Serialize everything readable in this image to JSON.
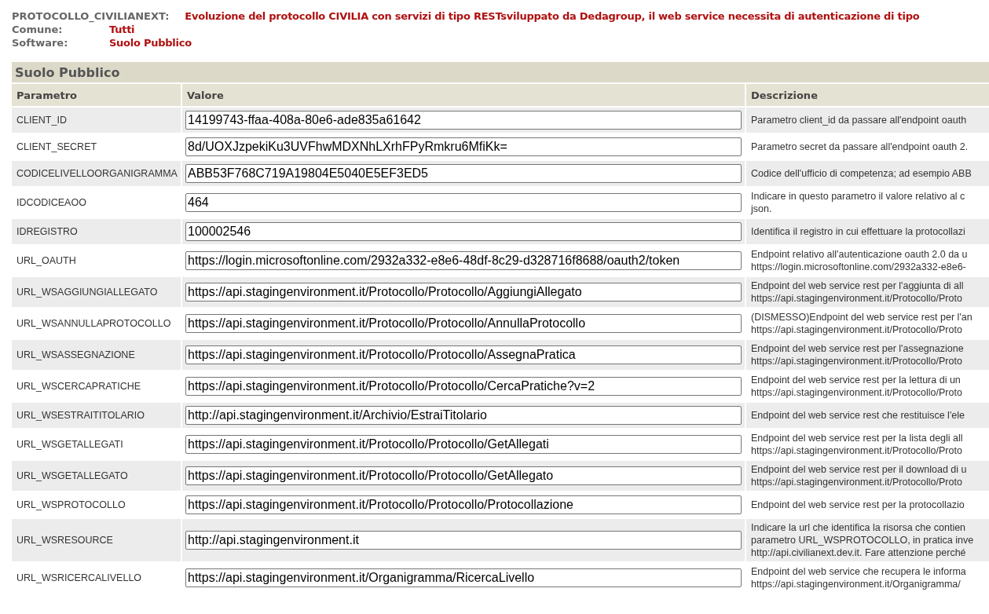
{
  "info": [
    {
      "label": "PROTOCOLLO_CIVILIANEXT:",
      "value": "Evoluzione del protocollo CIVILIA con servizi di tipo RESTsviluppato da Dedagroup, il web service necessita di autenticazione di tipo"
    },
    {
      "label": "Comune:",
      "value": "Tutti"
    },
    {
      "label": "Software:",
      "value": "Suolo Pubblico"
    }
  ],
  "section_title": "Suolo Pubblico",
  "columns": [
    "Parametro",
    "Valore",
    "Descrizione"
  ],
  "rows": [
    {
      "parameter": "CLIENT_ID",
      "value": "14199743-ffaa-408a-80e6-ade835a61642",
      "description": [
        "Parametro client_id da passare all'endpoint oauth"
      ]
    },
    {
      "parameter": "CLIENT_SECRET",
      "value": "8d/UOXJzpekiKu3UVFhwMDXNhLXrhFPyRmkru6MfiKk=",
      "description": [
        "Parametro secret da passare all'endpoint oauth 2."
      ]
    },
    {
      "parameter": "CODICELIVELLOORGANIGRAMMA",
      "value": "ABB53F768C719A19804E5040E5EF3ED5",
      "description": [
        "Codice dell'ufficio di competenza; ad esempio ABB"
      ]
    },
    {
      "parameter": "IDCODICEAOO",
      "value": "464",
      "description": [
        "Indicare in questo parametro il valore relativo al c",
        "json."
      ]
    },
    {
      "parameter": "IDREGISTRO",
      "value": "100002546",
      "description": [
        "Identifica il registro in cui effettuare la protocollazi"
      ]
    },
    {
      "parameter": "URL_OAUTH",
      "value": "https://login.microsoftonline.com/2932a332-e8e6-48df-8c29-d328716f8688/oauth2/token",
      "description": [
        "Endpoint relativo all'autenticazione oauth 2.0 da u",
        "https://login.microsoftonline.com/2932a332-e8e6-"
      ]
    },
    {
      "parameter": "URL_WSAGGIUNGIALLEGATO",
      "value": "https://api.stagingenvironment.it/Protocollo/Protocollo/AggiungiAllegato",
      "description": [
        "Endpoint del web service rest per l'aggiunta di all",
        "https://api.stagingenvironment.it/Protocollo/Proto"
      ]
    },
    {
      "parameter": "URL_WSANNULLAPROTOCOLLO",
      "value": "https://api.stagingenvironment.it/Protocollo/Protocollo/AnnullaProtocollo",
      "description": [
        "(DISMESSO)Endpoint del web service rest per l'an",
        "https://api.stagingenvironment.it/Protocollo/Proto"
      ]
    },
    {
      "parameter": "URL_WSASSEGNAZIONE",
      "value": "https://api.stagingenvironment.it/Protocollo/Protocollo/AssegnaPratica",
      "description": [
        "Endpoint del web service rest per l'assegnazione",
        "https://api.stagingenvironment.it/Protocollo/Proto"
      ]
    },
    {
      "parameter": "URL_WSCERCAPRATICHE",
      "value": "https://api.stagingenvironment.it/Protocollo/Protocollo/CercaPratiche?v=2",
      "description": [
        "Endpoint del web service rest per la lettura di un",
        "https://api.stagingenvironment.it/Protocollo/Proto"
      ]
    },
    {
      "parameter": "URL_WSESTRAITITOLARIO",
      "value": "http://api.stagingenvironment.it/Archivio/EstraiTitolario",
      "description": [
        "Endpoint del web service rest che restituisce l'ele"
      ]
    },
    {
      "parameter": "URL_WSGETALLEGATI",
      "value": "https://api.stagingenvironment.it/Protocollo/Protocollo/GetAllegati",
      "description": [
        "Endpoint del web service rest per la lista degli all",
        "https://api.stagingenvironment.it/Protocollo/Proto"
      ]
    },
    {
      "parameter": "URL_WSGETALLEGATO",
      "value": "https://api.stagingenvironment.it/Protocollo/Protocollo/GetAllegato",
      "description": [
        "Endpoint del web service rest per il download di u",
        "https://api.stagingenvironment.it/Protocollo/Proto"
      ]
    },
    {
      "parameter": "URL_WSPROTOCOLLO",
      "value": "https://api.stagingenvironment.it/Protocollo/Protocollo/Protocollazione",
      "description": [
        "Endpoint del web service rest per la protocollazio"
      ]
    },
    {
      "parameter": "URL_WSRESOURCE",
      "value": "http://api.stagingenvironment.it",
      "description": [
        "Indicare la url che identifica la risorsa che contien",
        "parametro URL_WSPROTOCOLLO, in pratica inve",
        "http://api.civilianext.dev.it. Fare attenzione perché"
      ]
    },
    {
      "parameter": "URL_WSRICERCALIVELLO",
      "value": "https://api.stagingenvironment.it/Organigramma/RicercaLivello",
      "description": [
        "Endpoint del web service che recupera le informa",
        "https://api.stagingenvironment.it/Organigramma/"
      ]
    }
  ]
}
